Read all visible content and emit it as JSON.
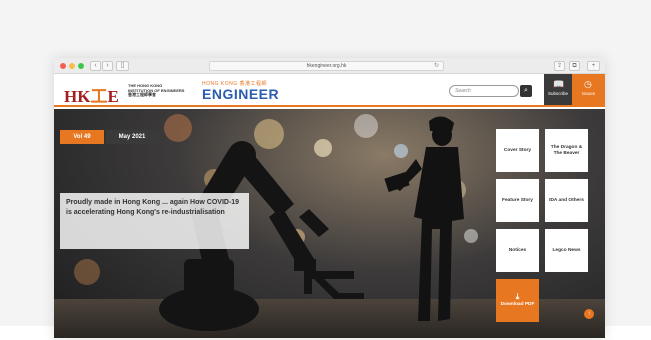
{
  "browser": {
    "url": "hkengineer.org.hk",
    "back_icon": "chevron-left-icon",
    "forward_icon": "chevron-right-icon",
    "sidebar_icon": "sidebar-icon",
    "reload_icon": "reload-icon",
    "share_icon": "share-icon",
    "tabs_icon": "tabs-icon"
  },
  "header": {
    "hkie_logo_text": "HK",
    "hkie_logo_mark": "工",
    "hkie_logo_end": "E",
    "institution_name": "THE HONG KONG INSTITUTION OF ENGINEERS",
    "institution_name_cn": "香港工程師學會",
    "magazine_small": "HONG KONG 香港工程師",
    "magazine_big": "ENGINEER",
    "search_placeholder": "Search",
    "subscribe_label": "Subscribe",
    "issues_label": "Issues",
    "accent_color": "#e87722"
  },
  "hero": {
    "volume": "Vol 49",
    "date": "May 2021",
    "headline": "Proudly made in Hong Kong ... again How COVID-19 is accelerating Hong Kong's re-industrialisation",
    "tiles": [
      {
        "label": "Cover Story"
      },
      {
        "label": "The Dragon & The Beaver"
      },
      {
        "label": "Feature Story"
      },
      {
        "label": "IDA and Others"
      },
      {
        "label": "Notices"
      },
      {
        "label": "Legco News"
      }
    ],
    "download_label": "Download PDF",
    "download_icon": "download-icon"
  }
}
